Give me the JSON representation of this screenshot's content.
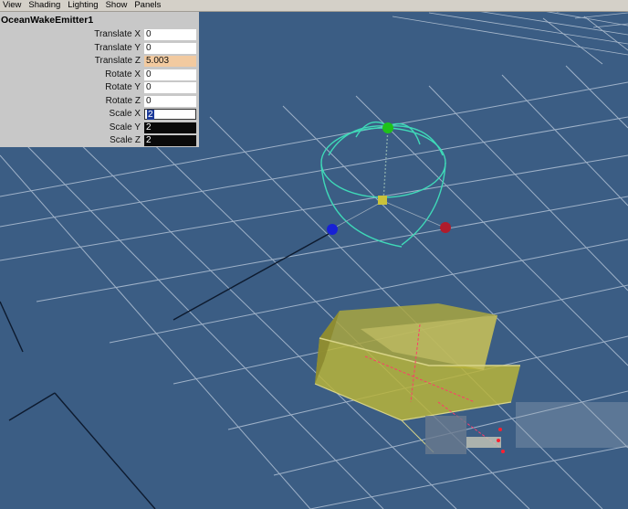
{
  "menubar": {
    "items": [
      "View",
      "Shading",
      "Lighting",
      "Show",
      "Panels"
    ]
  },
  "channel_box": {
    "object_name": "OceanWakeEmitter1",
    "attributes": [
      {
        "label": "Translate X",
        "value": "0",
        "state": "normal"
      },
      {
        "label": "Translate Y",
        "value": "0",
        "state": "normal"
      },
      {
        "label": "Translate Z",
        "value": "5.003",
        "state": "keyed"
      },
      {
        "label": "Rotate X",
        "value": "0",
        "state": "normal"
      },
      {
        "label": "Rotate Y",
        "value": "0",
        "state": "normal"
      },
      {
        "label": "Rotate Z",
        "value": "0",
        "state": "normal"
      },
      {
        "label": "Scale X",
        "value": "2",
        "state": "editing"
      },
      {
        "label": "Scale Y",
        "value": "2",
        "state": "dark"
      },
      {
        "label": "Scale Z",
        "value": "2",
        "state": "dark"
      }
    ]
  },
  "colors": {
    "viewport_bg": "#3b5d84",
    "grid": "#a8b8cc",
    "emitter_wire": "#3fd9b8",
    "boat_fill": "#b8b43a",
    "keyed_field": "#f2caa0"
  },
  "icons": {
    "emitter_top_handle": "green-sphere-icon",
    "emitter_left_handle": "blue-sphere-icon",
    "emitter_right_handle": "red-sphere-icon",
    "emitter_center_handle": "yellow-cube-icon"
  }
}
